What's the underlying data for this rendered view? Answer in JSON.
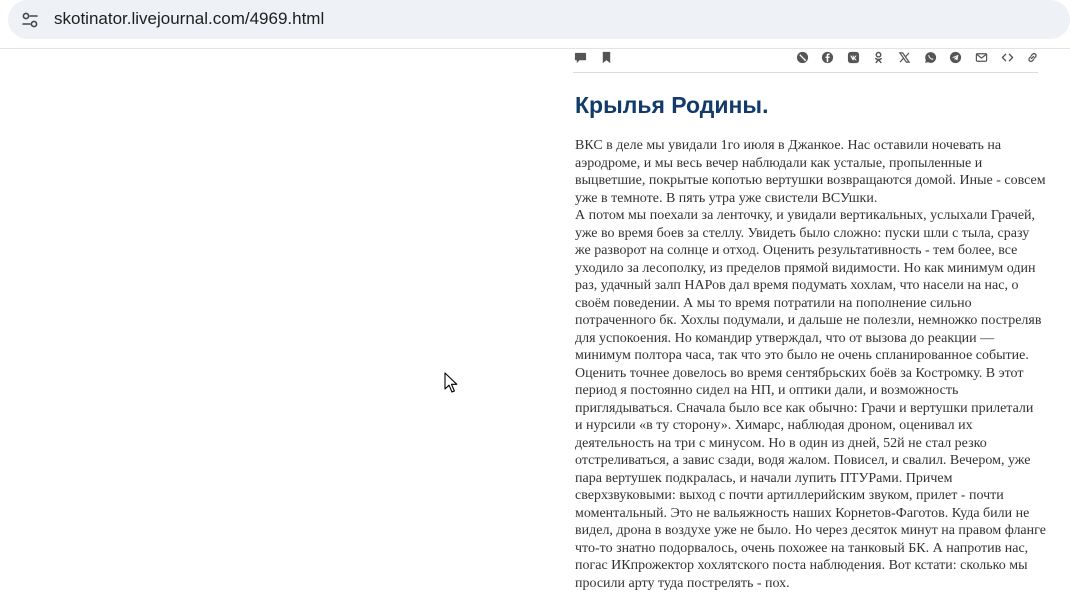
{
  "browser": {
    "url": "skotinator.livejournal.com/4969.html"
  },
  "post_toolbar": {
    "left_icons": [
      "comment-icon",
      "bookmark-icon"
    ],
    "share_icons": [
      "livejournal-icon",
      "facebook-icon",
      "vk-icon",
      "odnoklassniki-icon",
      "x-icon",
      "whatsapp-icon",
      "telegram-icon",
      "email-icon",
      "embed-icon",
      "link-icon"
    ]
  },
  "post": {
    "title": "Крылья Родины.",
    "lines": [
      "ВКС в деле мы увидали 1го июля в Джанкое. Нас оставили ночевать на",
      "аэродроме, и мы весь вечер наблюдали как усталые, пропыленные и",
      "выцветшие, покрытые копотью вертушки возвращаются домой. Иные - совсем",
      "уже в темноте. В пять утра уже свистели ВСУшки.",
      "А потом мы поехали за ленточку, и увидали вертикальных, услыхали Грачей,",
      "уже во время боев за стеллу. Увидеть было сложно: пуски шли с тыла, сразу",
      "же разворот на солнце и отход. Оценить результативность - тем более, все",
      "уходило за лесополку, из пределов прямой видимости. Но как минимум один",
      "раз, удачный залп НАРов дал время подумать хохлам, что насели на нас, о",
      "своём поведении. А мы то время потратили на пополнение сильно",
      "потраченного бк. Хохлы подумали, и дальше не полезли, немножко постреляв",
      "для успокоения. Но командир утверждал, что от вызова до реакции —",
      "минимум полтора часа, так что это было не очень спланированное событие.",
      " Оценить точнее довелось во время сентябрьских боёв за Костромку. В этот",
      "период я постоянно сидел на НП, и оптики дали, и возможность",
      "приглядываться. Сначала было все как обычно: Грачи и вертушки прилетали",
      "и нурсили «в ту сторону». Химарс, наблюдая дроном, оценивал их",
      "деятельность на три с минусом. Но в один из дней, 52й не стал резко",
      "отстреливаться, а завис сзади, водя жалом. Повисел, и свалил. Вечером, уже",
      "пара вертушек подкралась, и начали лупить ПТУРами. Причем",
      "сверхзвуковыми: выход с почти артиллерийским звуком, прилет - почти",
      "моментальный. Это не вальяжность наших Корнетов-Фаготов. Куда били не",
      "видел, дрона в воздухе уже не было. Но через десяток минут на правом фланге",
      "что-то знатно подорвалось, очень похожее на танковый БК. А напротив нас,",
      "погас ИКпрожектор хохлятского поста наблюдения. Вот кстати: сколько мы",
      "просили арту туда пострелять - пох."
    ]
  },
  "colors": {
    "title": "#123b6b",
    "body_text": "#333333",
    "icon": "#555555",
    "omnibox_bg": "#eef1f6"
  }
}
